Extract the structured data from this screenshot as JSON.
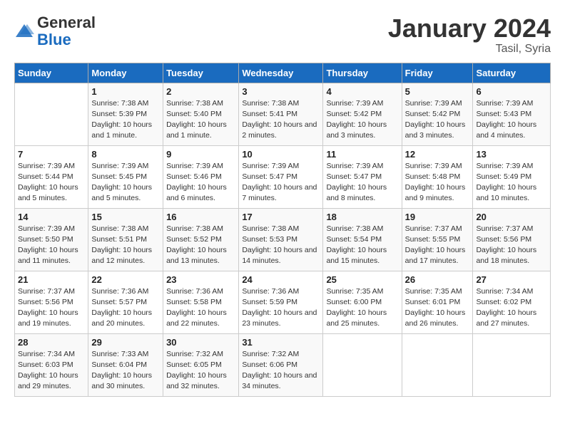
{
  "header": {
    "logo_general": "General",
    "logo_blue": "Blue",
    "cal_title": "January 2024",
    "cal_subtitle": "Tasil, Syria"
  },
  "days_of_week": [
    "Sunday",
    "Monday",
    "Tuesday",
    "Wednesday",
    "Thursday",
    "Friday",
    "Saturday"
  ],
  "weeks": [
    [
      {
        "day": "",
        "sunrise": "",
        "sunset": "",
        "daylight": ""
      },
      {
        "day": "1",
        "sunrise": "Sunrise: 7:38 AM",
        "sunset": "Sunset: 5:39 PM",
        "daylight": "Daylight: 10 hours and 1 minute."
      },
      {
        "day": "2",
        "sunrise": "Sunrise: 7:38 AM",
        "sunset": "Sunset: 5:40 PM",
        "daylight": "Daylight: 10 hours and 1 minute."
      },
      {
        "day": "3",
        "sunrise": "Sunrise: 7:38 AM",
        "sunset": "Sunset: 5:41 PM",
        "daylight": "Daylight: 10 hours and 2 minutes."
      },
      {
        "day": "4",
        "sunrise": "Sunrise: 7:39 AM",
        "sunset": "Sunset: 5:42 PM",
        "daylight": "Daylight: 10 hours and 3 minutes."
      },
      {
        "day": "5",
        "sunrise": "Sunrise: 7:39 AM",
        "sunset": "Sunset: 5:42 PM",
        "daylight": "Daylight: 10 hours and 3 minutes."
      },
      {
        "day": "6",
        "sunrise": "Sunrise: 7:39 AM",
        "sunset": "Sunset: 5:43 PM",
        "daylight": "Daylight: 10 hours and 4 minutes."
      }
    ],
    [
      {
        "day": "7",
        "sunrise": "Sunrise: 7:39 AM",
        "sunset": "Sunset: 5:44 PM",
        "daylight": "Daylight: 10 hours and 5 minutes."
      },
      {
        "day": "8",
        "sunrise": "Sunrise: 7:39 AM",
        "sunset": "Sunset: 5:45 PM",
        "daylight": "Daylight: 10 hours and 5 minutes."
      },
      {
        "day": "9",
        "sunrise": "Sunrise: 7:39 AM",
        "sunset": "Sunset: 5:46 PM",
        "daylight": "Daylight: 10 hours and 6 minutes."
      },
      {
        "day": "10",
        "sunrise": "Sunrise: 7:39 AM",
        "sunset": "Sunset: 5:47 PM",
        "daylight": "Daylight: 10 hours and 7 minutes."
      },
      {
        "day": "11",
        "sunrise": "Sunrise: 7:39 AM",
        "sunset": "Sunset: 5:47 PM",
        "daylight": "Daylight: 10 hours and 8 minutes."
      },
      {
        "day": "12",
        "sunrise": "Sunrise: 7:39 AM",
        "sunset": "Sunset: 5:48 PM",
        "daylight": "Daylight: 10 hours and 9 minutes."
      },
      {
        "day": "13",
        "sunrise": "Sunrise: 7:39 AM",
        "sunset": "Sunset: 5:49 PM",
        "daylight": "Daylight: 10 hours and 10 minutes."
      }
    ],
    [
      {
        "day": "14",
        "sunrise": "Sunrise: 7:39 AM",
        "sunset": "Sunset: 5:50 PM",
        "daylight": "Daylight: 10 hours and 11 minutes."
      },
      {
        "day": "15",
        "sunrise": "Sunrise: 7:38 AM",
        "sunset": "Sunset: 5:51 PM",
        "daylight": "Daylight: 10 hours and 12 minutes."
      },
      {
        "day": "16",
        "sunrise": "Sunrise: 7:38 AM",
        "sunset": "Sunset: 5:52 PM",
        "daylight": "Daylight: 10 hours and 13 minutes."
      },
      {
        "day": "17",
        "sunrise": "Sunrise: 7:38 AM",
        "sunset": "Sunset: 5:53 PM",
        "daylight": "Daylight: 10 hours and 14 minutes."
      },
      {
        "day": "18",
        "sunrise": "Sunrise: 7:38 AM",
        "sunset": "Sunset: 5:54 PM",
        "daylight": "Daylight: 10 hours and 15 minutes."
      },
      {
        "day": "19",
        "sunrise": "Sunrise: 7:37 AM",
        "sunset": "Sunset: 5:55 PM",
        "daylight": "Daylight: 10 hours and 17 minutes."
      },
      {
        "day": "20",
        "sunrise": "Sunrise: 7:37 AM",
        "sunset": "Sunset: 5:56 PM",
        "daylight": "Daylight: 10 hours and 18 minutes."
      }
    ],
    [
      {
        "day": "21",
        "sunrise": "Sunrise: 7:37 AM",
        "sunset": "Sunset: 5:56 PM",
        "daylight": "Daylight: 10 hours and 19 minutes."
      },
      {
        "day": "22",
        "sunrise": "Sunrise: 7:36 AM",
        "sunset": "Sunset: 5:57 PM",
        "daylight": "Daylight: 10 hours and 20 minutes."
      },
      {
        "day": "23",
        "sunrise": "Sunrise: 7:36 AM",
        "sunset": "Sunset: 5:58 PM",
        "daylight": "Daylight: 10 hours and 22 minutes."
      },
      {
        "day": "24",
        "sunrise": "Sunrise: 7:36 AM",
        "sunset": "Sunset: 5:59 PM",
        "daylight": "Daylight: 10 hours and 23 minutes."
      },
      {
        "day": "25",
        "sunrise": "Sunrise: 7:35 AM",
        "sunset": "Sunset: 6:00 PM",
        "daylight": "Daylight: 10 hours and 25 minutes."
      },
      {
        "day": "26",
        "sunrise": "Sunrise: 7:35 AM",
        "sunset": "Sunset: 6:01 PM",
        "daylight": "Daylight: 10 hours and 26 minutes."
      },
      {
        "day": "27",
        "sunrise": "Sunrise: 7:34 AM",
        "sunset": "Sunset: 6:02 PM",
        "daylight": "Daylight: 10 hours and 27 minutes."
      }
    ],
    [
      {
        "day": "28",
        "sunrise": "Sunrise: 7:34 AM",
        "sunset": "Sunset: 6:03 PM",
        "daylight": "Daylight: 10 hours and 29 minutes."
      },
      {
        "day": "29",
        "sunrise": "Sunrise: 7:33 AM",
        "sunset": "Sunset: 6:04 PM",
        "daylight": "Daylight: 10 hours and 30 minutes."
      },
      {
        "day": "30",
        "sunrise": "Sunrise: 7:32 AM",
        "sunset": "Sunset: 6:05 PM",
        "daylight": "Daylight: 10 hours and 32 minutes."
      },
      {
        "day": "31",
        "sunrise": "Sunrise: 7:32 AM",
        "sunset": "Sunset: 6:06 PM",
        "daylight": "Daylight: 10 hours and 34 minutes."
      },
      {
        "day": "",
        "sunrise": "",
        "sunset": "",
        "daylight": ""
      },
      {
        "day": "",
        "sunrise": "",
        "sunset": "",
        "daylight": ""
      },
      {
        "day": "",
        "sunrise": "",
        "sunset": "",
        "daylight": ""
      }
    ]
  ]
}
